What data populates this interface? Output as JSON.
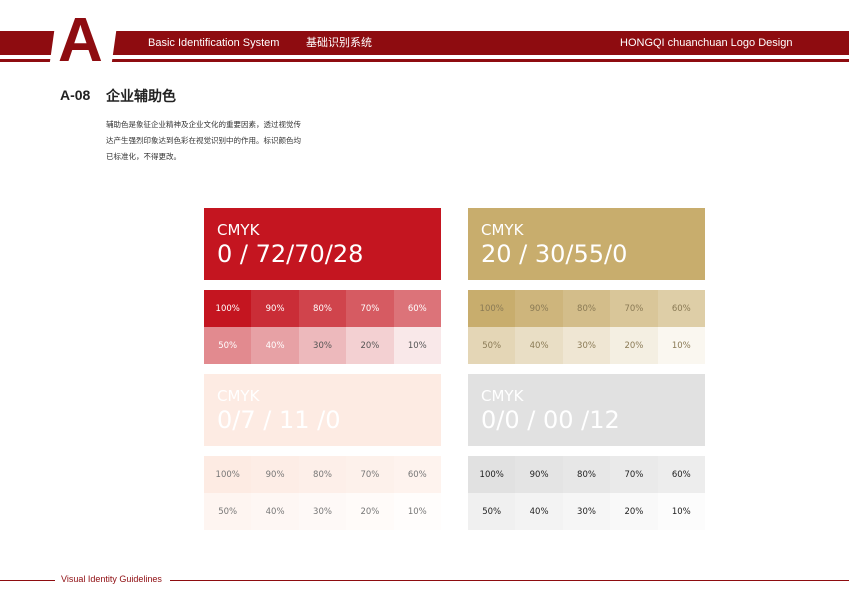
{
  "header": {
    "letter": "A",
    "subtitle_en": "Basic Identification System",
    "subtitle_cn": "基础识别系统",
    "right_title": "HONGQI chuanchuan Logo Design"
  },
  "section": {
    "code": "A-08",
    "title": "企业辅助色",
    "description": "辅助色是象征企业精神及企业文化的重要因素，透过视觉传达产生强烈印象达到色彩在视觉识别中的作用。标识颜色均已标准化，不得更改。"
  },
  "colors": [
    {
      "label": "CMYK",
      "value": "0 / 72/70/28",
      "base": "#c41520",
      "text_color": "#ffffff",
      "tints": [
        "100%",
        "90%",
        "80%",
        "70%",
        "60%",
        "50%",
        "40%",
        "30%",
        "20%",
        "10%"
      ],
      "tint_colors": [
        "#c41520",
        "#ca2d37",
        "#d0444c",
        "#d65b62",
        "#dc7379",
        "#e28a8f",
        "#e7a1a5",
        "#edb9bc",
        "#f3d0d2",
        "#f9e8e9"
      ],
      "tint_text": [
        "#ffffff",
        "#ffffff",
        "#ffffff",
        "#ffffff",
        "#ffffff",
        "#ffffff",
        "#ffffff",
        "#555555",
        "#555555",
        "#555555"
      ]
    },
    {
      "label": "CMYK",
      "value": "20 / 30/55/0",
      "base": "#c8ad6d",
      "text_color": "#ffffff",
      "tints": [
        "100%",
        "90%",
        "80%",
        "70%",
        "60%",
        "50%",
        "40%",
        "30%",
        "20%",
        "10%"
      ],
      "tint_colors": [
        "#c8ad6d",
        "#ceb57c",
        "#d3bd8a",
        "#d9c699",
        "#decea7",
        "#e4d6b6",
        "#e9dec5",
        "#efe6d3",
        "#f4efe2",
        "#faf7f0"
      ],
      "tint_text": [
        "#8a7a55",
        "#8a7a55",
        "#8a7a55",
        "#8a7a55",
        "#8a7a55",
        "#8a7a55",
        "#8a7a55",
        "#8a7a55",
        "#8a7a55",
        "#8a7a55"
      ]
    },
    {
      "label": "CMYK",
      "value": "0/7 / 11 /0",
      "base": "#fdebe3",
      "text_color": "#ffffff",
      "tints": [
        "100%",
        "90%",
        "80%",
        "70%",
        "60%",
        "50%",
        "40%",
        "30%",
        "20%",
        "10%"
      ],
      "tint_colors": [
        "#fdebe3",
        "#fdede6",
        "#fdefe9",
        "#fdf1eb",
        "#fef3ee",
        "#fef5f1",
        "#fef7f4",
        "#fef9f7",
        "#fffbf9",
        "#fffdfc"
      ],
      "tint_text": [
        "#777777",
        "#777777",
        "#777777",
        "#777777",
        "#777777",
        "#777777",
        "#777777",
        "#777777",
        "#777777",
        "#777777"
      ]
    },
    {
      "label": "CMYK",
      "value": "0/0 / 00 /12",
      "base": "#e1e1e1",
      "text_color": "#ffffff",
      "tints": [
        "100%",
        "90%",
        "80%",
        "70%",
        "60%",
        "50%",
        "40%",
        "30%",
        "20%",
        "10%"
      ],
      "tint_colors": [
        "#e1e1e1",
        "#e4e4e4",
        "#e7e7e7",
        "#eaeaea",
        "#ededed",
        "#f0f0f0",
        "#f3f3f3",
        "#f6f6f6",
        "#f9f9f9",
        "#fcfcfc"
      ],
      "tint_text": [
        "#222222",
        "#222222",
        "#222222",
        "#222222",
        "#222222",
        "#222222",
        "#222222",
        "#222222",
        "#222222",
        "#222222"
      ]
    }
  ],
  "footer": {
    "text": "Visual Identity Guidelines"
  }
}
